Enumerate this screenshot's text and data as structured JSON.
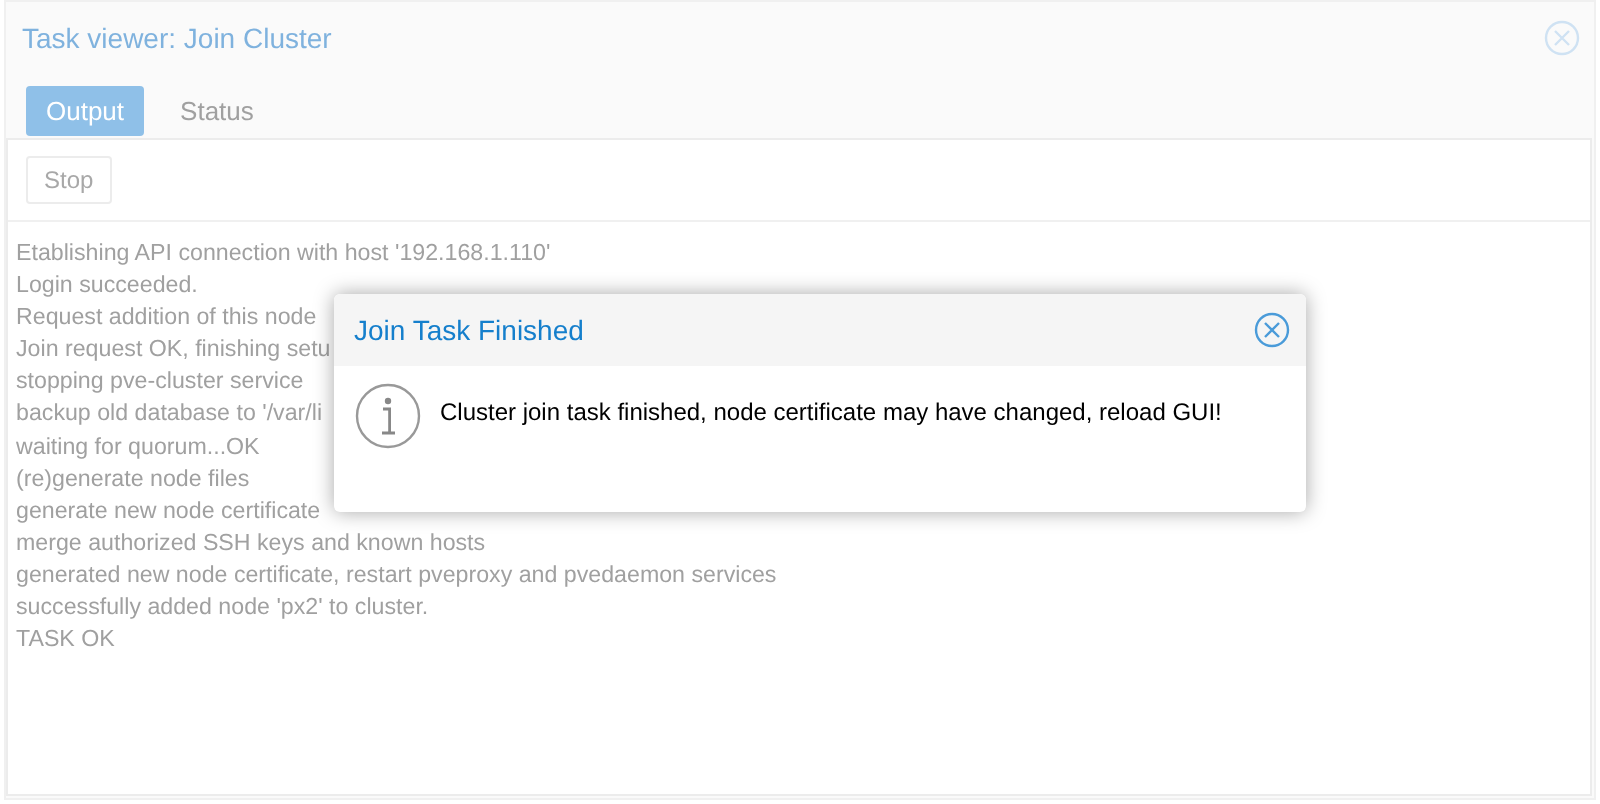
{
  "window": {
    "title": "Task viewer: Join Cluster"
  },
  "tabs": [
    {
      "label": "Output",
      "selected": true
    },
    {
      "label": "Status",
      "selected": false
    }
  ],
  "toolbar": {
    "button": "Stop"
  },
  "log": [
    "Etablishing API connection with host '192.168.1.110'",
    "Login succeeded.",
    "Request addition of this node",
    "Join request OK, finishing setu",
    "stopping pve-cluster service",
    "backup old database to '/var/li",
    "waiting for quorum...OK",
    "(re)generate node files",
    "generate new node certificate",
    "merge authorized SSH keys and known hosts",
    "generated new node certificate, restart pveproxy and pvedaemon services",
    "successfully added node 'px2' to cluster.",
    "TASK OK"
  ],
  "dialog": {
    "title": "Join Task Finished",
    "message": "Cluster join task finished, node certificate may have changed, reload GUI!"
  }
}
